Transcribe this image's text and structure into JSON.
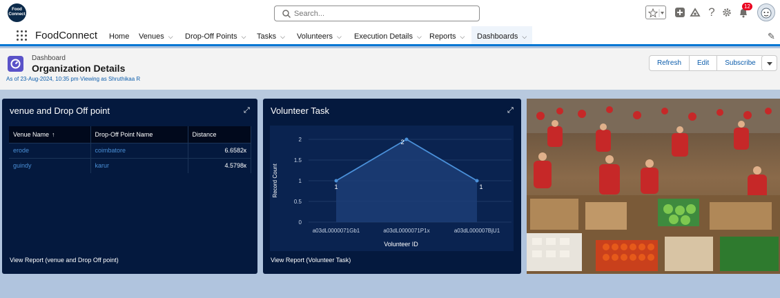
{
  "header": {
    "logo_text": "Food Connect",
    "search_placeholder": "Search...",
    "notification_count": "12",
    "icons": [
      "star-icon",
      "chevron-down-icon",
      "add-icon",
      "trailhead-icon",
      "help-icon",
      "settings-icon",
      "bell-icon",
      "avatar"
    ]
  },
  "nav": {
    "app_name": "FoodConnect",
    "items": [
      {
        "label": "Home",
        "chevron": false
      },
      {
        "label": "Venues",
        "chevron": true
      },
      {
        "label": "Drop-Off Points",
        "chevron": true
      },
      {
        "label": "Tasks",
        "chevron": true
      },
      {
        "label": "Volunteers",
        "chevron": true
      },
      {
        "label": "Execution Details",
        "chevron": true
      },
      {
        "label": "Reports",
        "chevron": true
      },
      {
        "label": "Dashboards",
        "chevron": true,
        "active": true
      }
    ]
  },
  "dashboard": {
    "object_label": "Dashboard",
    "title": "Organization Details",
    "meta": "As of 23-Aug-2024, 10:35 pm·Viewing as Shruthikaa R",
    "buttons": {
      "refresh": "Refresh",
      "edit": "Edit",
      "subscribe": "Subscribe"
    }
  },
  "widget_venue": {
    "title": "venue and Drop Off point",
    "columns": [
      "Venue Name",
      "Drop-Off Point Name",
      "Distance"
    ],
    "sort_indicator": "↑",
    "rows": [
      [
        "erode",
        "coimbatore",
        "6.6582к"
      ],
      [
        "guindy",
        "karur",
        "4.5798к"
      ]
    ],
    "footer": "View Report (venue and Drop Off point)"
  },
  "widget_task": {
    "title": "Volunteer Task",
    "footer": "View Report (Volunteer Task)"
  },
  "chart_data": {
    "type": "line",
    "title": "Volunteer Task",
    "categories": [
      "a03dL0000071Gb1",
      "a03dL0000071P1x",
      "a03dL000007BjU1"
    ],
    "values": [
      1,
      2,
      1
    ],
    "data_labels": [
      "1",
      "2",
      "1"
    ],
    "xlabel": "Volunteer ID",
    "ylabel": "Record Count",
    "yticks": [
      "0",
      "0.5",
      "1",
      "1.5",
      "2"
    ],
    "ylim": [
      0,
      2
    ],
    "color": "#4a90d9",
    "fill": true
  },
  "colors": {
    "brand": "#0176d3",
    "widget_bg": "#04193e",
    "page_bg": "#b0c4de"
  }
}
